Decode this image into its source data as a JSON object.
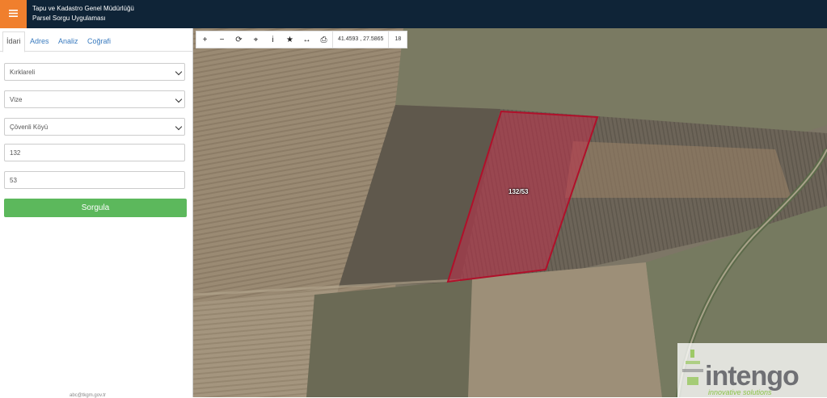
{
  "header": {
    "title_line1": "Tapu ve Kadastro Genel Müdürlüğü",
    "title_line2": "Parsel Sorgu Uygulaması",
    "menu_icon": "hamburger-icon"
  },
  "sidebar": {
    "tabs": [
      {
        "label": "İdari"
      },
      {
        "label": "Adres"
      },
      {
        "label": "Analiz"
      },
      {
        "label": "Coğrafi"
      }
    ],
    "fields": {
      "province": "Kırklareli",
      "district": "Vize",
      "neighborhood": "Çövenli Köyü",
      "block": "132",
      "parcel": "53"
    },
    "query_button": "Sorgula",
    "footer": "abc@tkgm.gov.tr"
  },
  "map": {
    "toolbar": {
      "coordinates": "41.4593 , 27.5865",
      "zoom": "18"
    },
    "parcel_label": "132/53",
    "logo_text": "intengo",
    "logo_subtext": "innovative solutions",
    "colors": {
      "parcel_fill": "#c0304a",
      "parcel_stroke": "#b0102a",
      "topbar": "#0f2437",
      "accent": "#f07f2d",
      "button": "#5cb85c"
    }
  }
}
